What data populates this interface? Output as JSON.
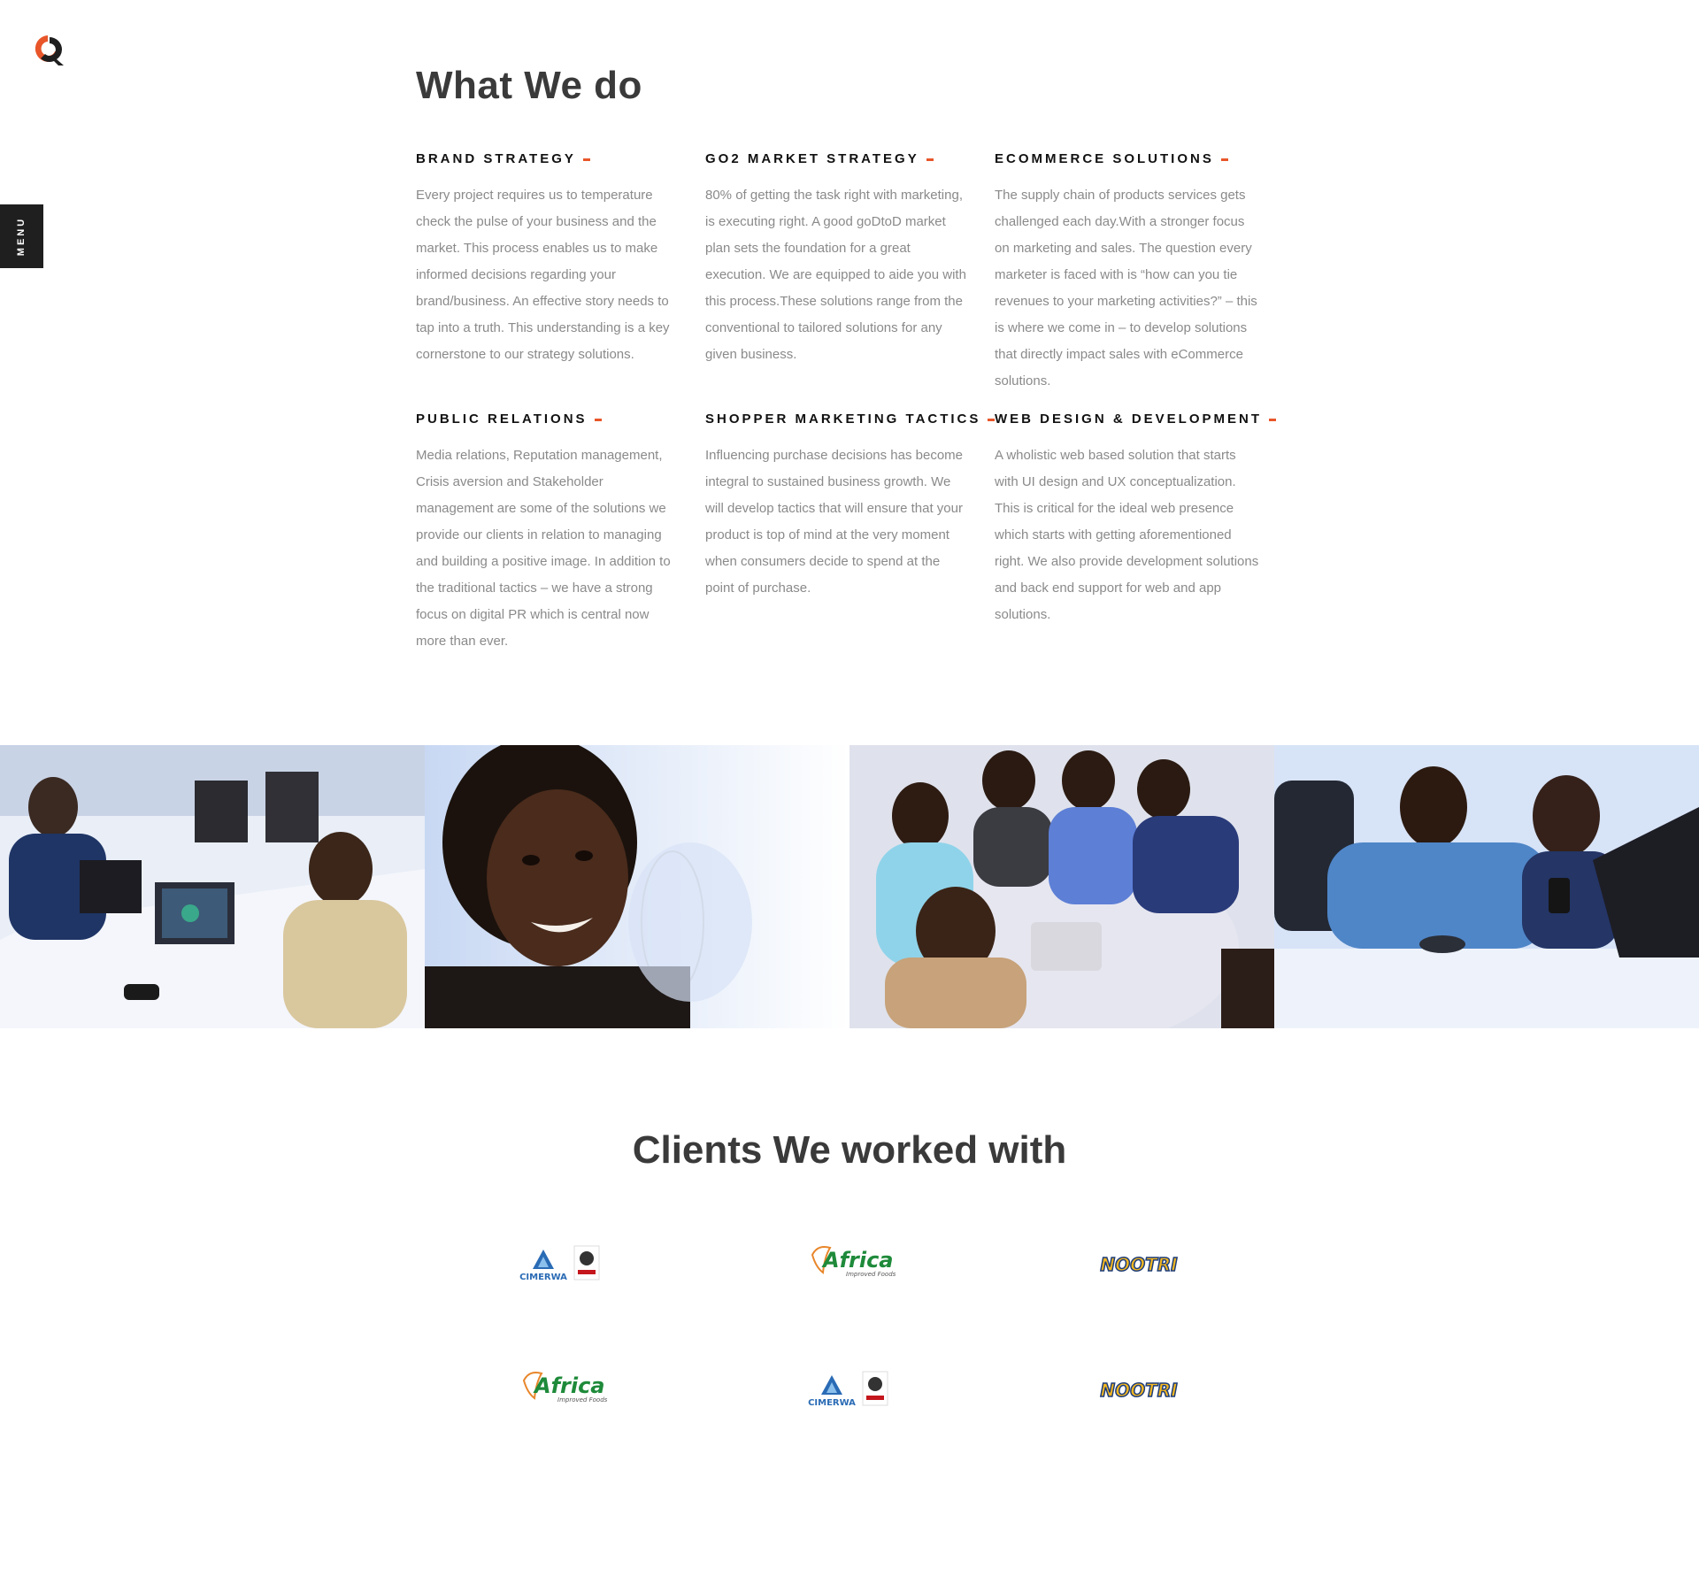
{
  "header": {
    "menu_label": "MENU"
  },
  "services_section": {
    "title": "What We do",
    "items": [
      {
        "title": "BRAND STRATEGY",
        "text": "Every project requires us to temperature check the pulse of your business and the market. This process enables us to make informed decisions regarding your brand/business. An effective story needs to tap into a truth. This understanding is a key cornerstone to our strategy solutions."
      },
      {
        "title": "GO2 MARKET STRATEGY",
        "text": "80% of getting the task right with marketing, is executing right. A good goDtoD market plan sets the foundation for a great execution. We are equipped to aide you with this process.These solutions range from the conventional to tailored solutions for any given business."
      },
      {
        "title": "ECOMMERCE SOLUTIONS",
        "text": "The supply chain of products services gets challenged each day.With a stronger focus on marketing and sales. The question every marketer is faced with is “how can you tie revenues to your marketing activities?” – this is where we come in – to develop solutions that directly impact sales with eCommerce solutions."
      },
      {
        "title": "PUBLIC RELATIONS",
        "text": "Media relations, Reputation management, Crisis aversion and Stakeholder management are some of the solutions we provide our clients in relation to managing and building a positive image. In addition to the traditional tactics – we have a strong focus on digital PR which is central now more than ever."
      },
      {
        "title": "SHOPPER MARKETING TACTICS",
        "text": "Influencing purchase decisions has become integral to sustained business growth. We will develop tactics that will ensure that your product is top of mind at the very moment when consumers decide to spend at the point of purchase."
      },
      {
        "title": "WEB DESIGN & DEVELOPMENT",
        "text": "A wholistic web based solution that starts with UI design and UX conceptualization. This is critical for the ideal web presence which starts with getting aforementioned right. We also provide development solutions and back end support for web and app solutions."
      }
    ]
  },
  "clients_section": {
    "title": "Clients We worked with",
    "logos": [
      {
        "name": "cimerwa",
        "text": "CIMERWA"
      },
      {
        "name": "africa-improved-foods",
        "text": "Africa",
        "sub": "Improved Foods"
      },
      {
        "name": "nootri",
        "text": "NOOTRI"
      },
      {
        "name": "africa-improved-foods",
        "text": "Africa",
        "sub": "Improved Foods"
      },
      {
        "name": "cimerwa",
        "text": "CIMERWA"
      },
      {
        "name": "nootri",
        "text": "NOOTRI"
      }
    ]
  },
  "colors": {
    "accent": "#e8562a",
    "heading": "#3a3a3a",
    "body_text": "#8a8a8a",
    "menu_bg": "#1f1f1f"
  }
}
